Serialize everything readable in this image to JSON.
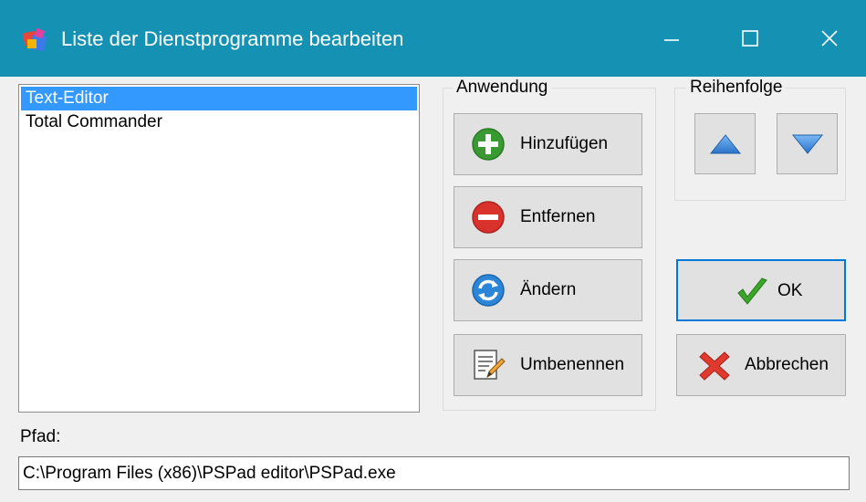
{
  "window": {
    "title": "Liste der Dienstprogramme bearbeiten",
    "title_bar_color": "#1592b3",
    "controls": {
      "minimize": "minimize-icon",
      "maximize": "maximize-icon",
      "close": "close-icon"
    }
  },
  "list": {
    "items": [
      {
        "label": "Text-Editor",
        "selected": true
      },
      {
        "label": "Total Commander",
        "selected": false
      }
    ],
    "selection_color": "#3399ff"
  },
  "anwendung": {
    "title": "Anwendung",
    "add_label": "Hinzufügen",
    "remove_label": "Entfernen",
    "change_label": "Ändern",
    "rename_label": "Umbenennen"
  },
  "reihenfolge": {
    "title": "Reihenfolge",
    "up_icon": "arrow-up-icon",
    "down_icon": "arrow-down-icon"
  },
  "dialog": {
    "ok_label": "OK",
    "cancel_label": "Abbrechen"
  },
  "path": {
    "label": "Pfad:",
    "value": "C:\\Program Files (x86)\\PSPad editor\\PSPad.exe"
  }
}
